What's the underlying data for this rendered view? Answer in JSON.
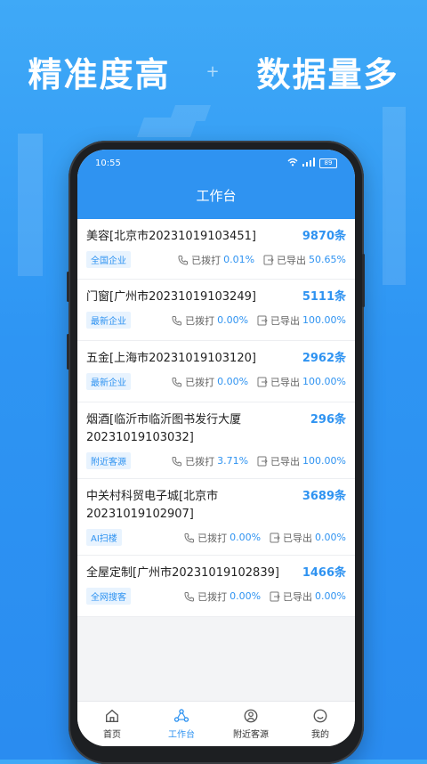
{
  "banner": {
    "left": "精准度高",
    "separator": "+",
    "right": "数据量多"
  },
  "status": {
    "time": "10:55",
    "battery": "89"
  },
  "app": {
    "title": "工作台"
  },
  "list": [
    {
      "name": "美容[北京市20231019103451]",
      "count": "9870条",
      "tag": "全国企业",
      "dialed_label": "已拨打",
      "dialed": "0.01%",
      "exported_label": "已导出",
      "exported": "50.65%"
    },
    {
      "name": "门窗[广州市20231019103249]",
      "count": "5111条",
      "tag": "最新企业",
      "dialed_label": "已拨打",
      "dialed": "0.00%",
      "exported_label": "已导出",
      "exported": "100.00%"
    },
    {
      "name": "五金[上海市20231019103120]",
      "count": "2962条",
      "tag": "最新企业",
      "dialed_label": "已拨打",
      "dialed": "0.00%",
      "exported_label": "已导出",
      "exported": "100.00%"
    },
    {
      "name": "烟酒[临沂市临沂图书发行大厦20231019103032]",
      "count": "296条",
      "tag": "附近客源",
      "dialed_label": "已拨打",
      "dialed": "3.71%",
      "exported_label": "已导出",
      "exported": "100.00%"
    },
    {
      "name": "中关村科贸电子城[北京市20231019102907]",
      "count": "3689条",
      "tag": "AI扫楼",
      "dialed_label": "已拨打",
      "dialed": "0.00%",
      "exported_label": "已导出",
      "exported": "0.00%"
    },
    {
      "name": "全屋定制[广州市20231019102839]",
      "count": "1466条",
      "tag": "全网搜客",
      "dialed_label": "已拨打",
      "dialed": "0.00%",
      "exported_label": "已导出",
      "exported": "0.00%"
    }
  ],
  "nav": [
    {
      "label": "首页",
      "icon": "home-icon"
    },
    {
      "label": "工作台",
      "icon": "workbench-icon"
    },
    {
      "label": "附近客源",
      "icon": "nearby-icon"
    },
    {
      "label": "我的",
      "icon": "profile-icon"
    }
  ],
  "colors": {
    "accent": "#2f93f1",
    "background": "#3fa9f7"
  }
}
